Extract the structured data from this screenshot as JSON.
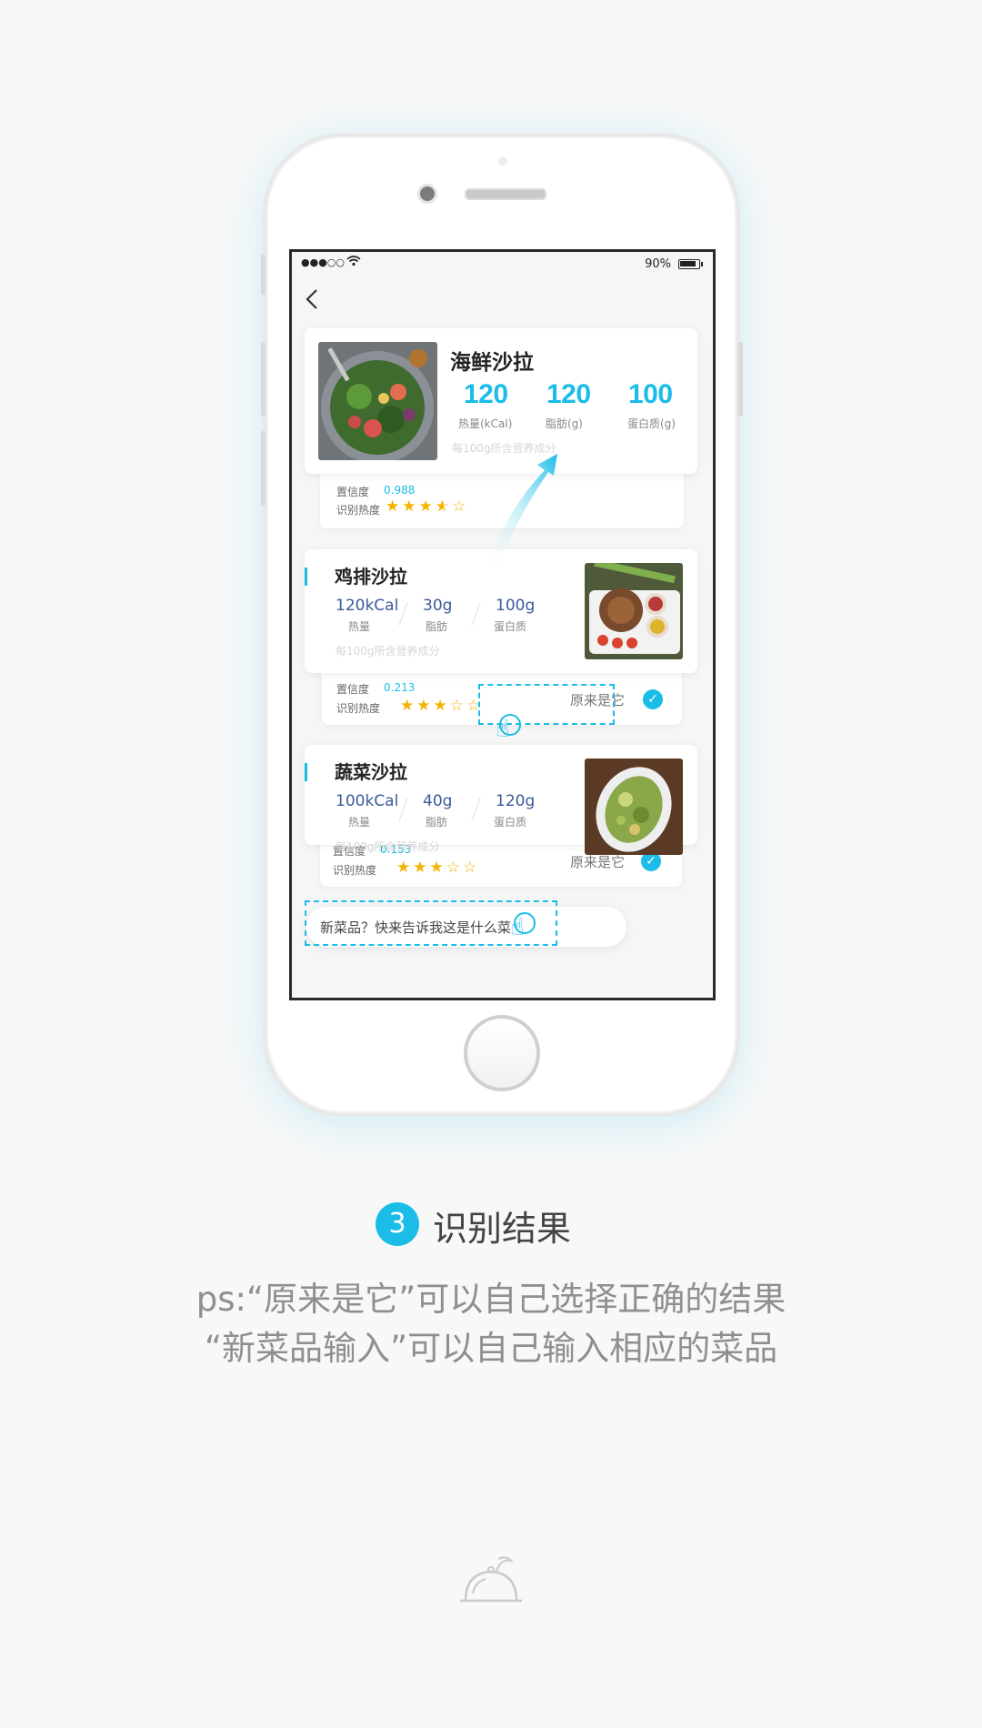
{
  "status_bar": {
    "signal": "●●●○○",
    "wifi": "wifi-icon",
    "battery_percent": "90%"
  },
  "nav": {
    "back_icon": "chevron-left-icon"
  },
  "result": {
    "name": "海鲜沙拉",
    "stats": [
      {
        "value": "120",
        "label": "热量(kCal)"
      },
      {
        "value": "120",
        "label": "脂肪(g)"
      },
      {
        "value": "100",
        "label": "蛋白质(g)"
      }
    ],
    "note": "每100g所含营养成分",
    "confidence_label": "置信度",
    "confidence_value": "0.988",
    "popularity_label": "识别热度",
    "rating": 3.5
  },
  "candidates": [
    {
      "name": "鸡排沙拉",
      "stats": [
        {
          "value": "120kCal",
          "label": "热量"
        },
        {
          "value": "30g",
          "label": "脂肪"
        },
        {
          "value": "100g",
          "label": "蛋白质"
        }
      ],
      "note": "每100g所含营养成分",
      "confidence_label": "置信度",
      "confidence_value": "0.213",
      "popularity_label": "识别热度",
      "rating": 3,
      "confirm_label": "原来是它"
    },
    {
      "name": "蔬菜沙拉",
      "stats": [
        {
          "value": "100kCal",
          "label": "热量"
        },
        {
          "value": "40g",
          "label": "脂肪"
        },
        {
          "value": "120g",
          "label": "蛋白质"
        }
      ],
      "note": "每100g所含营养成分",
      "confidence_label": "置信度",
      "confidence_value": "0.153",
      "popularity_label": "识别热度",
      "rating": 3,
      "confirm_label": "原来是它"
    }
  ],
  "new_dish_prompt": "新菜品？快来告诉我这是什么菜",
  "step": {
    "number": "3",
    "title": "识别结果"
  },
  "captions": [
    "ps:“原来是它”可以自己选择正确的结果",
    "“新菜品输入”可以自己输入相应的菜品"
  ],
  "colors": {
    "accent": "#1bbde8",
    "star": "#f5b300",
    "stat_blue": "#3a5a99"
  }
}
